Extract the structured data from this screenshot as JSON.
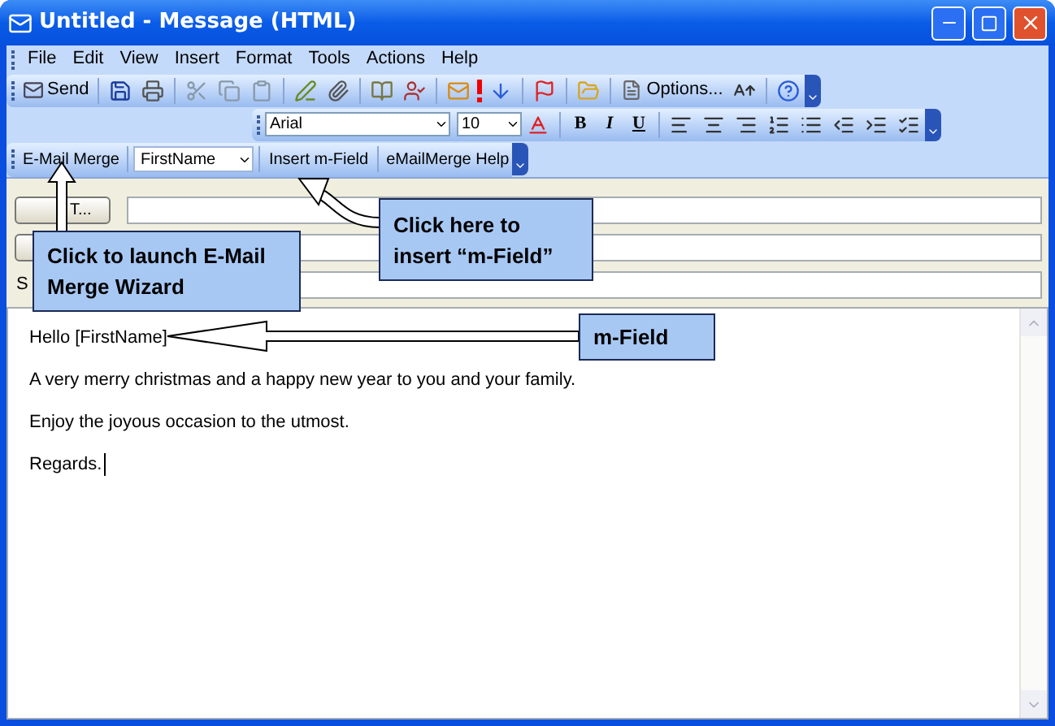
{
  "window": {
    "title": "Untitled - Message (HTML)"
  },
  "menu": [
    "File",
    "Edit",
    "View",
    "Insert",
    "Format",
    "Tools",
    "Actions",
    "Help"
  ],
  "standard_toolbar": {
    "send": "Send",
    "options": "Options..."
  },
  "format_toolbar": {
    "font": "Arial",
    "size": "10",
    "bold": "B",
    "italic": "I",
    "underline": "U"
  },
  "merge_toolbar": {
    "merge": "E-Mail Merge",
    "field": "FirstName",
    "insert": "Insert m-Field",
    "help": "eMailMerge Help"
  },
  "header": {
    "to_button": "T...",
    "subject_label": "S"
  },
  "body": [
    "Hello [FirstName]",
    "A very merry christmas and a happy new year to you and your family.",
    "Enjoy the joyous occasion to the utmost.",
    "Regards."
  ],
  "callouts": [
    {
      "kind": "launch",
      "text": "Click to launch E-Mail Merge Wizard"
    },
    {
      "kind": "insert",
      "text": "Click here to insert “m-Field”"
    },
    {
      "kind": "field",
      "text": "m-Field"
    }
  ]
}
